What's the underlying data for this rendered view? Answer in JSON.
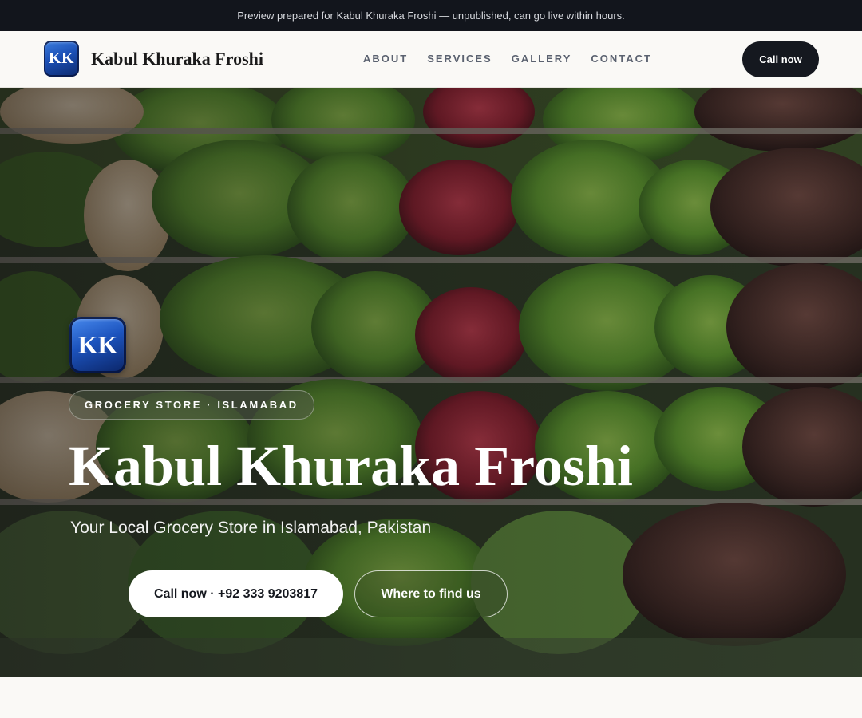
{
  "preview_bar": {
    "text": "Preview prepared for Kabul Khuraka Froshi — unpublished, can go live within hours."
  },
  "brand": {
    "logo_text": "KK",
    "name": "Kabul Khuraka Froshi"
  },
  "nav": {
    "links": [
      {
        "label": "ABOUT"
      },
      {
        "label": "SERVICES"
      },
      {
        "label": "GALLERY"
      },
      {
        "label": "CONTACT"
      }
    ],
    "cta_label": "Call now"
  },
  "hero": {
    "logo_text": "KK",
    "eyebrow": "GROCERY STORE · ISLAMABAD",
    "title": "Kabul Khuraka Froshi",
    "subtitle": "Your Local Grocery Store in Islamabad, Pakistan",
    "call_button": "Call now · +92 333 9203817",
    "find_button": "Where to find us",
    "background_image": "produce-shelves-photo"
  },
  "colors": {
    "dark": "#15181f",
    "brand_blue": "#1b4fb5",
    "page_bg": "#faf9f6"
  }
}
